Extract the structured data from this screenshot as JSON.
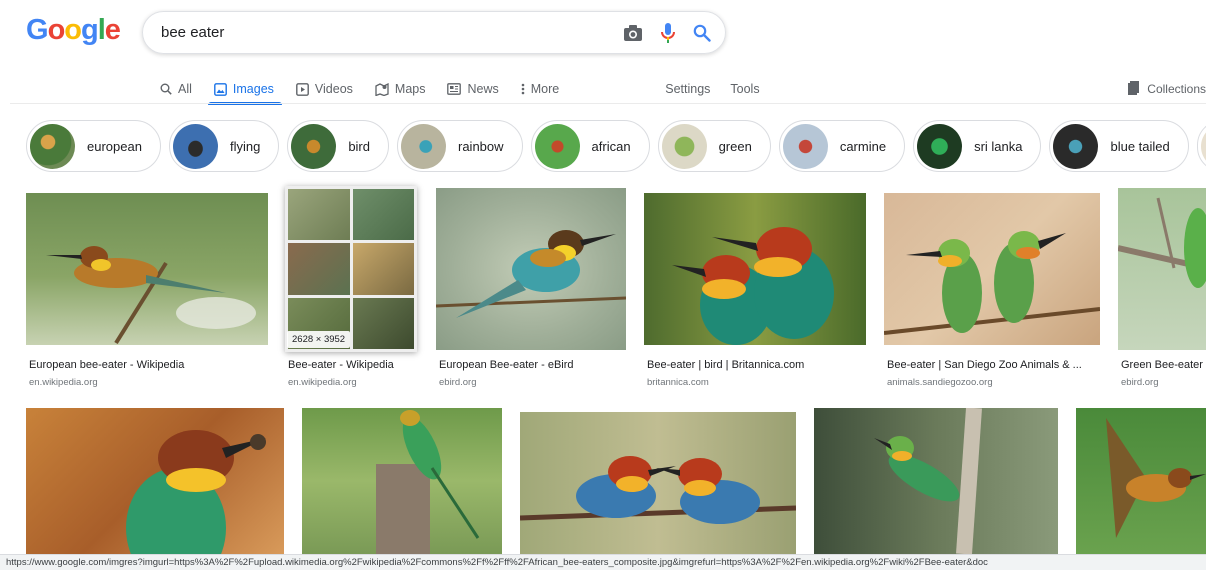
{
  "search": {
    "query": "bee eater"
  },
  "tabs": [
    {
      "label": "All"
    },
    {
      "label": "Images"
    },
    {
      "label": "Videos"
    },
    {
      "label": "Maps"
    },
    {
      "label": "News"
    },
    {
      "label": "More"
    }
  ],
  "tools": {
    "settings": "Settings",
    "tools": "Tools"
  },
  "collections": "Collections",
  "chips": [
    "european",
    "flying",
    "bird",
    "rainbow",
    "african",
    "green",
    "carmine",
    "sri lanka",
    "blue tailed"
  ],
  "results_row1": [
    {
      "title": "European bee-eater - Wikipedia",
      "source": "en.wikipedia.org"
    },
    {
      "title": "Bee-eater - Wikipedia",
      "source": "en.wikipedia.org",
      "dimensions": "2628 × 3952"
    },
    {
      "title": "European Bee-eater - eBird",
      "source": "ebird.org"
    },
    {
      "title": "Bee-eater | bird | Britannica.com",
      "source": "britannica.com"
    },
    {
      "title": "Bee-eater | San Diego Zoo Animals & ...",
      "source": "animals.sandiegozoo.org"
    },
    {
      "title": "Green Bee-eater",
      "source": "ebird.org"
    }
  ],
  "status_url": "https://www.google.com/imgres?imgurl=https%3A%2F%2Fupload.wikimedia.org%2Fwikipedia%2Fcommons%2Ff%2Fff%2FAfrican_bee-eaters_composite.jpg&imgrefurl=https%3A%2F%2Fen.wikipedia.org%2Fwiki%2FBee-eater&doc",
  "colors": {
    "accent": "#1a73e8",
    "logo_blue": "#4285f4",
    "logo_red": "#ea4335",
    "logo_yellow": "#fbbc05",
    "logo_green": "#34a853"
  },
  "icons": [
    "camera-icon",
    "microphone-icon",
    "search-icon",
    "images-icon",
    "videos-icon",
    "maps-icon",
    "news-icon",
    "more-icon",
    "collections-icon"
  ]
}
